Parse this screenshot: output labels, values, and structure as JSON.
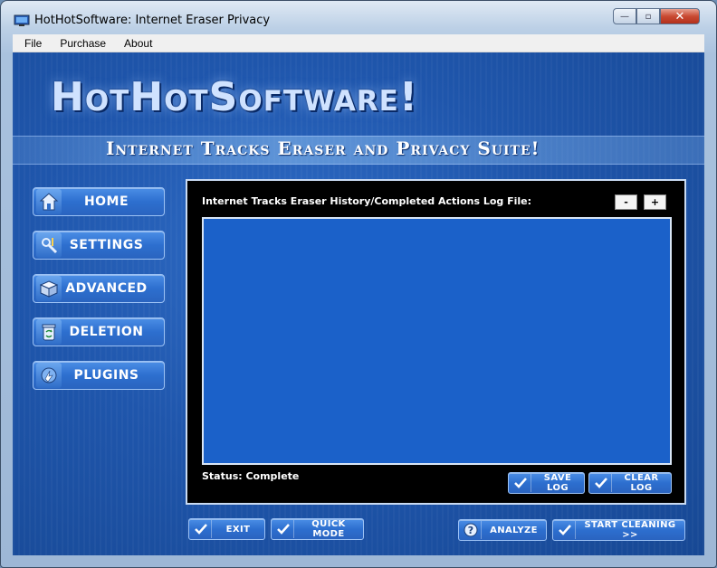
{
  "window": {
    "title": "HotHotSoftware: Internet Eraser Privacy",
    "minimize": "—",
    "maximize": "▫",
    "close": "✕"
  },
  "menu": {
    "file": "File",
    "purchase": "Purchase",
    "about": "About"
  },
  "header": {
    "logo": "HotHotSoftware!",
    "tagline": "Internet Tracks Eraser and Privacy Suite!"
  },
  "nav": {
    "home": "HOME",
    "settings": "SETTINGS",
    "advanced": "ADVANCED",
    "deletion": "DELETION",
    "plugins": "PLUGINS"
  },
  "log_panel": {
    "title": "Internet Tracks Eraser History/Completed Actions Log File:",
    "zoom_out": "-",
    "zoom_in": "+",
    "status": "Status: Complete",
    "save_log": "SAVE LOG",
    "clear_log": "CLEAR LOG"
  },
  "footer": {
    "exit": "EXIT",
    "quick_mode": "QUICK MODE",
    "analyze": "ANALYZE",
    "start_cleaning": "START CLEANING >>"
  },
  "colors": {
    "client_bg": "#1f56ac",
    "log_bg": "#1b61c9",
    "button": "#2d6fcf"
  }
}
